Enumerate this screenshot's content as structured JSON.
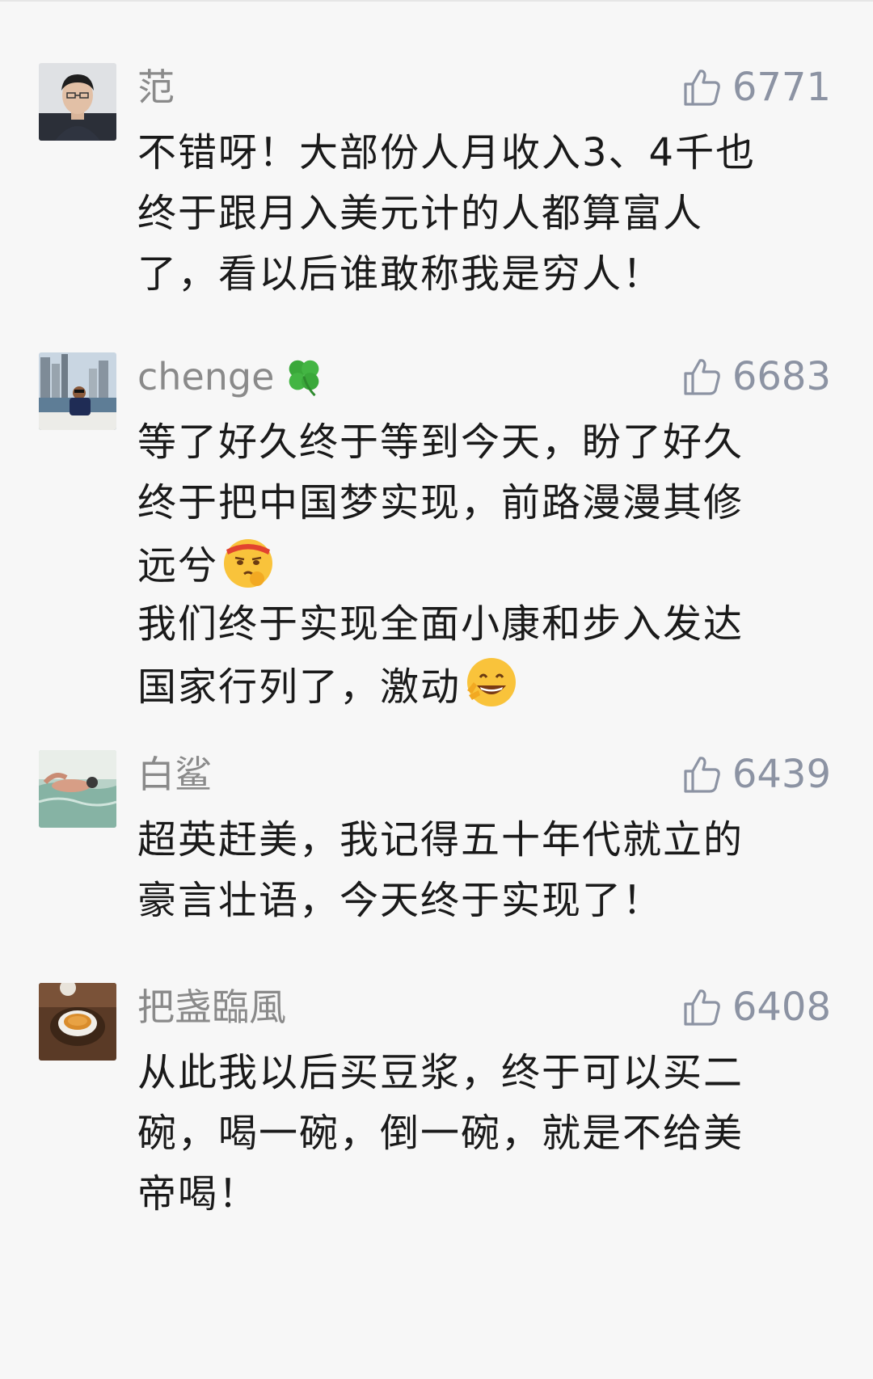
{
  "comments": [
    {
      "nickname": "范",
      "likes": "6771",
      "avatar_icon": "avatar-man-portrait",
      "lines": [
        "不错呀！大部份人月收入3、4千也",
        "终于跟月入美元计的人都算富人",
        "了，看以后谁敢称我是穷人！"
      ]
    },
    {
      "nickname": "chenge",
      "nickname_emoji": "four-leaf-clover-icon",
      "likes": "6683",
      "avatar_icon": "avatar-city-skyline",
      "lines": [
        "等了好久终于等到今天，盼了好久",
        "终于把中国梦实现，前路漫漫其修",
        "远兮",
        "我们终于实现全面小康和步入发达",
        "国家行列了，激动"
      ]
    },
    {
      "nickname": "白鲨",
      "likes": "6439",
      "avatar_icon": "avatar-swimmer",
      "lines": [
        "超英赶美，我记得五十年代就立的",
        "豪言壮语，今天终于实现了！"
      ]
    },
    {
      "nickname": "把盏臨風",
      "likes": "6408",
      "avatar_icon": "avatar-tea-cup",
      "lines": [
        "从此我以后买豆浆，终于可以买二",
        "碗，喝一碗，倒一碗，就是不给美",
        "帝喝！"
      ]
    }
  ],
  "colors": {
    "background": "#f7f7f7",
    "nickname": "#8a8a8a",
    "like": "#8c93a3",
    "text": "#1a1a1a"
  }
}
